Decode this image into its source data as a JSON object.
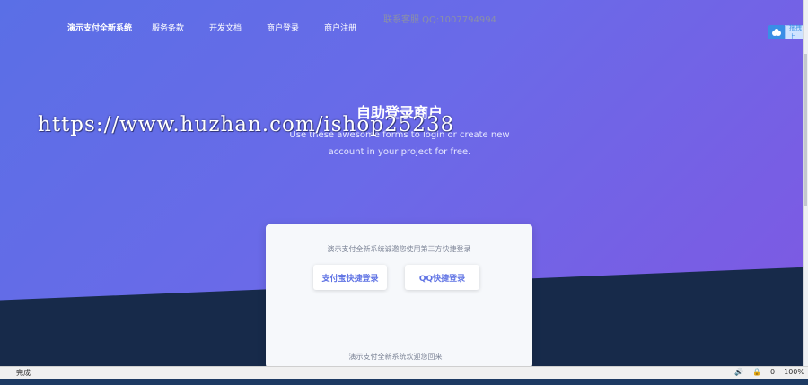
{
  "nav": {
    "brand": "演示支付全新系统",
    "items": [
      "服务条款",
      "开发文档",
      "商户登录",
      "商户注册"
    ]
  },
  "service_contact": "联系客服 QQ:1007794994",
  "hero": {
    "title": "自助登录商户",
    "subtitle_line1": "Use these awesome forms to login or create new",
    "subtitle_line2": "account in your project for free.",
    "watermark": "https://www.huzhan.com/ishop25238"
  },
  "card": {
    "hint": "演示支付全新系统诚邀您使用第三方快捷登录",
    "alipay_label": "支付宝快捷登录",
    "qq_label": "QQ快捷登录",
    "welcome": "演示支付全新系统欢迎您回来！"
  },
  "side_widget": {
    "label": "拖拽上"
  },
  "statusbar": {
    "text": "完成",
    "items": [
      "0",
      "100%"
    ]
  },
  "colors": {
    "accent": "#5e72e4",
    "dark": "#172a4a"
  }
}
